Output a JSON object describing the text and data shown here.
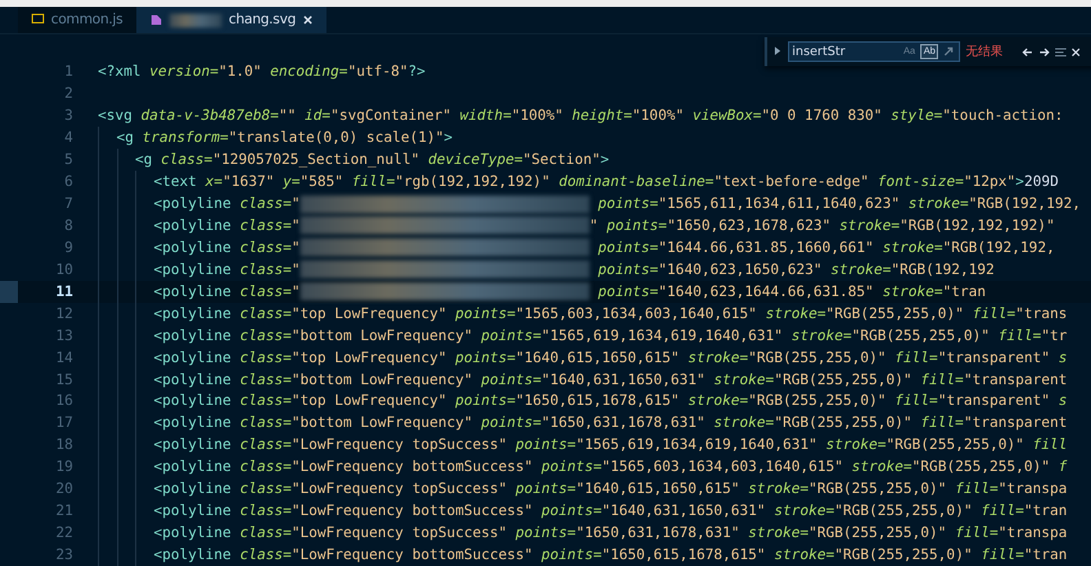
{
  "tabs": [
    {
      "label": "common.js",
      "kind": "js",
      "selected": false,
      "redacted": false,
      "closable": false
    },
    {
      "label": "chang.svg",
      "kind": "svg",
      "selected": true,
      "redacted": true,
      "closable": true
    }
  ],
  "find_widget": {
    "expanded": false,
    "query": "insertStr",
    "options": [
      {
        "kind": "text",
        "label": "Aa",
        "selected": false
      },
      {
        "kind": "text",
        "label": "Ab",
        "selected": true
      },
      {
        "kind": "regex",
        "selected": false
      }
    ],
    "status": "无结果"
  },
  "lines": [
    {
      "number": "1",
      "current": false,
      "tokens": [
        {
          "kind": "tag",
          "text": "<?xml"
        },
        {
          "kind": "attr",
          "text": " version="
        },
        {
          "kind": "string",
          "text": "\"1.0\""
        },
        {
          "kind": "attr",
          "text": " encoding="
        },
        {
          "kind": "string",
          "text": "\"utf-8\""
        },
        {
          "kind": "tag",
          "text": "?>"
        }
      ]
    },
    {
      "number": "2",
      "current": false
    },
    {
      "number": "3",
      "current": false,
      "tokens": [
        {
          "kind": "tag",
          "text": "<svg"
        },
        {
          "kind": "attr",
          "text": " data-v-3b487eb8="
        },
        {
          "kind": "string",
          "text": "\"\""
        },
        {
          "kind": "attr",
          "text": " id="
        },
        {
          "kind": "string",
          "text": "\"svgContainer\""
        },
        {
          "kind": "attr",
          "text": " width="
        },
        {
          "kind": "string",
          "text": "\"100%\""
        },
        {
          "kind": "attr",
          "text": " height="
        },
        {
          "kind": "string",
          "text": "\"100%\""
        },
        {
          "kind": "attr",
          "text": " viewBox="
        },
        {
          "kind": "string",
          "text": "\"0 0 1760 830\""
        },
        {
          "kind": "attr",
          "text": " style="
        },
        {
          "kind": "string",
          "text": "\"touch-action:"
        }
      ]
    },
    {
      "number": "4",
      "current": false,
      "tokens": [
        {
          "kind": "tag",
          "text": "  <g"
        },
        {
          "kind": "attr",
          "text": " transform="
        },
        {
          "kind": "string",
          "text": "\"translate(0,0) scale(1)\""
        },
        {
          "kind": "tag",
          "text": ">"
        }
      ]
    },
    {
      "number": "5",
      "current": false,
      "tokens": [
        {
          "kind": "tag",
          "text": "    <g"
        },
        {
          "kind": "attr",
          "text": " class="
        },
        {
          "kind": "string",
          "text": "\"129057025_Section_null\""
        },
        {
          "kind": "attr",
          "text": " deviceType="
        },
        {
          "kind": "string",
          "text": "\"Section\""
        },
        {
          "kind": "tag",
          "text": ">"
        }
      ]
    },
    {
      "number": "6",
      "current": false,
      "tokens": [
        {
          "kind": "tag",
          "text": "      <text"
        },
        {
          "kind": "attr",
          "text": " x="
        },
        {
          "kind": "string",
          "text": "\"1637\""
        },
        {
          "kind": "attr",
          "text": " y="
        },
        {
          "kind": "string",
          "text": "\"585\""
        },
        {
          "kind": "attr",
          "text": " fill="
        },
        {
          "kind": "string",
          "text": "\"rgb(192,192,192)\""
        },
        {
          "kind": "attr",
          "text": " dominant-baseline="
        },
        {
          "kind": "string",
          "text": "\"text-before-edge\""
        },
        {
          "kind": "attr",
          "text": " font-size="
        },
        {
          "kind": "string",
          "text": "\"12px\""
        },
        {
          "kind": "tag",
          "text": ">"
        },
        {
          "kind": "text",
          "text": "209D"
        }
      ]
    },
    {
      "number": "7",
      "current": false,
      "tokens": [
        {
          "kind": "tag",
          "text": "      <polyline"
        },
        {
          "kind": "attr",
          "text": " class="
        },
        {
          "kind": "string",
          "text": "\""
        },
        {
          "kind": "redacted"
        },
        {
          "kind": "attr",
          "text": " points="
        },
        {
          "kind": "string",
          "text": "\"1565,611,1634,611,1640,623\""
        },
        {
          "kind": "attr",
          "text": " stroke="
        },
        {
          "kind": "string",
          "text": "\"RGB(192,192,"
        }
      ]
    },
    {
      "number": "8",
      "current": false,
      "tokens": [
        {
          "kind": "tag",
          "text": "      <polyline"
        },
        {
          "kind": "attr",
          "text": " class="
        },
        {
          "kind": "string",
          "text": "\""
        },
        {
          "kind": "redacted"
        },
        {
          "kind": "string",
          "text": "\""
        },
        {
          "kind": "attr",
          "text": " points="
        },
        {
          "kind": "string",
          "text": "\"1650,623,1678,623\""
        },
        {
          "kind": "attr",
          "text": " stroke="
        },
        {
          "kind": "string",
          "text": "\"RGB(192,192,192)\""
        }
      ]
    },
    {
      "number": "9",
      "current": false,
      "tokens": [
        {
          "kind": "tag",
          "text": "      <polyline"
        },
        {
          "kind": "attr",
          "text": " class="
        },
        {
          "kind": "string",
          "text": "\""
        },
        {
          "kind": "redacted"
        },
        {
          "kind": "attr",
          "text": " points="
        },
        {
          "kind": "string",
          "text": "\"1644.66,631.85,1660,661\""
        },
        {
          "kind": "attr",
          "text": " stroke="
        },
        {
          "kind": "string",
          "text": "\"RGB(192,192,"
        }
      ]
    },
    {
      "number": "10",
      "current": false,
      "tokens": [
        {
          "kind": "tag",
          "text": "      <polyline"
        },
        {
          "kind": "attr",
          "text": " class="
        },
        {
          "kind": "string",
          "text": "\""
        },
        {
          "kind": "redacted"
        },
        {
          "kind": "attr",
          "text": " points="
        },
        {
          "kind": "string",
          "text": "\"1640,623,1650,623\""
        },
        {
          "kind": "attr",
          "text": " stroke="
        },
        {
          "kind": "string",
          "text": "\"RGB(192,192"
        }
      ]
    },
    {
      "number": "11",
      "current": true,
      "tokens": [
        {
          "kind": "tag",
          "text": "      <polyline"
        },
        {
          "kind": "attr",
          "text": " class="
        },
        {
          "kind": "string",
          "text": "\""
        },
        {
          "kind": "redacted"
        },
        {
          "kind": "attr",
          "text": " points="
        },
        {
          "kind": "string",
          "text": "\"1640,623,1644.66,631.85\""
        },
        {
          "kind": "attr",
          "text": " stroke="
        },
        {
          "kind": "string",
          "text": "\"tran"
        }
      ]
    },
    {
      "number": "12",
      "current": false,
      "tokens": [
        {
          "kind": "tag",
          "text": "      <polyline"
        },
        {
          "kind": "attr",
          "text": " class="
        },
        {
          "kind": "string",
          "text": "\"top LowFrequency\""
        },
        {
          "kind": "attr",
          "text": " points="
        },
        {
          "kind": "string",
          "text": "\"1565,603,1634,603,1640,615\""
        },
        {
          "kind": "attr",
          "text": " stroke="
        },
        {
          "kind": "string",
          "text": "\"RGB(255,255,0)\""
        },
        {
          "kind": "attr",
          "text": " fill="
        },
        {
          "kind": "string",
          "text": "\"trans"
        }
      ]
    },
    {
      "number": "13",
      "current": false,
      "tokens": [
        {
          "kind": "tag",
          "text": "      <polyline"
        },
        {
          "kind": "attr",
          "text": " class="
        },
        {
          "kind": "string",
          "text": "\"bottom LowFrequency\""
        },
        {
          "kind": "attr",
          "text": " points="
        },
        {
          "kind": "string",
          "text": "\"1565,619,1634,619,1640,631\""
        },
        {
          "kind": "attr",
          "text": " stroke="
        },
        {
          "kind": "string",
          "text": "\"RGB(255,255,0)\""
        },
        {
          "kind": "attr",
          "text": " fill="
        },
        {
          "kind": "string",
          "text": "\"tr"
        }
      ]
    },
    {
      "number": "14",
      "current": false,
      "tokens": [
        {
          "kind": "tag",
          "text": "      <polyline"
        },
        {
          "kind": "attr",
          "text": " class="
        },
        {
          "kind": "string",
          "text": "\"top LowFrequency\""
        },
        {
          "kind": "attr",
          "text": " points="
        },
        {
          "kind": "string",
          "text": "\"1640,615,1650,615\""
        },
        {
          "kind": "attr",
          "text": " stroke="
        },
        {
          "kind": "string",
          "text": "\"RGB(255,255,0)\""
        },
        {
          "kind": "attr",
          "text": " fill="
        },
        {
          "kind": "string",
          "text": "\"transparent\""
        },
        {
          "kind": "attr",
          "text": " s"
        }
      ]
    },
    {
      "number": "15",
      "current": false,
      "tokens": [
        {
          "kind": "tag",
          "text": "      <polyline"
        },
        {
          "kind": "attr",
          "text": " class="
        },
        {
          "kind": "string",
          "text": "\"bottom LowFrequency\""
        },
        {
          "kind": "attr",
          "text": " points="
        },
        {
          "kind": "string",
          "text": "\"1640,631,1650,631\""
        },
        {
          "kind": "attr",
          "text": " stroke="
        },
        {
          "kind": "string",
          "text": "\"RGB(255,255,0)\""
        },
        {
          "kind": "attr",
          "text": " fill="
        },
        {
          "kind": "string",
          "text": "\"transparent"
        }
      ]
    },
    {
      "number": "16",
      "current": false,
      "tokens": [
        {
          "kind": "tag",
          "text": "      <polyline"
        },
        {
          "kind": "attr",
          "text": " class="
        },
        {
          "kind": "string",
          "text": "\"top LowFrequency\""
        },
        {
          "kind": "attr",
          "text": " points="
        },
        {
          "kind": "string",
          "text": "\"1650,615,1678,615\""
        },
        {
          "kind": "attr",
          "text": " stroke="
        },
        {
          "kind": "string",
          "text": "\"RGB(255,255,0)\""
        },
        {
          "kind": "attr",
          "text": " fill="
        },
        {
          "kind": "string",
          "text": "\"transparent\""
        },
        {
          "kind": "attr",
          "text": " s"
        }
      ]
    },
    {
      "number": "17",
      "current": false,
      "tokens": [
        {
          "kind": "tag",
          "text": "      <polyline"
        },
        {
          "kind": "attr",
          "text": " class="
        },
        {
          "kind": "string",
          "text": "\"bottom LowFrequency\""
        },
        {
          "kind": "attr",
          "text": " points="
        },
        {
          "kind": "string",
          "text": "\"1650,631,1678,631\""
        },
        {
          "kind": "attr",
          "text": " stroke="
        },
        {
          "kind": "string",
          "text": "\"RGB(255,255,0)\""
        },
        {
          "kind": "attr",
          "text": " fill="
        },
        {
          "kind": "string",
          "text": "\"transparent"
        }
      ]
    },
    {
      "number": "18",
      "current": false,
      "tokens": [
        {
          "kind": "tag",
          "text": "      <polyline"
        },
        {
          "kind": "attr",
          "text": " class="
        },
        {
          "kind": "string",
          "text": "\"LowFrequency topSuccess\""
        },
        {
          "kind": "attr",
          "text": " points="
        },
        {
          "kind": "string",
          "text": "\"1565,619,1634,619,1640,631\""
        },
        {
          "kind": "attr",
          "text": " stroke="
        },
        {
          "kind": "string",
          "text": "\"RGB(255,255,0)\""
        },
        {
          "kind": "attr",
          "text": " fill"
        }
      ]
    },
    {
      "number": "19",
      "current": false,
      "tokens": [
        {
          "kind": "tag",
          "text": "      <polyline"
        },
        {
          "kind": "attr",
          "text": " class="
        },
        {
          "kind": "string",
          "text": "\"LowFrequency bottomSuccess\""
        },
        {
          "kind": "attr",
          "text": " points="
        },
        {
          "kind": "string",
          "text": "\"1565,603,1634,603,1640,615\""
        },
        {
          "kind": "attr",
          "text": " stroke="
        },
        {
          "kind": "string",
          "text": "\"RGB(255,255,0)\""
        },
        {
          "kind": "attr",
          "text": " f"
        }
      ]
    },
    {
      "number": "20",
      "current": false,
      "tokens": [
        {
          "kind": "tag",
          "text": "      <polyline"
        },
        {
          "kind": "attr",
          "text": " class="
        },
        {
          "kind": "string",
          "text": "\"LowFrequency topSuccess\""
        },
        {
          "kind": "attr",
          "text": " points="
        },
        {
          "kind": "string",
          "text": "\"1640,615,1650,615\""
        },
        {
          "kind": "attr",
          "text": " stroke="
        },
        {
          "kind": "string",
          "text": "\"RGB(255,255,0)\""
        },
        {
          "kind": "attr",
          "text": " fill="
        },
        {
          "kind": "string",
          "text": "\"transpa"
        }
      ]
    },
    {
      "number": "21",
      "current": false,
      "tokens": [
        {
          "kind": "tag",
          "text": "      <polyline"
        },
        {
          "kind": "attr",
          "text": " class="
        },
        {
          "kind": "string",
          "text": "\"LowFrequency bottomSuccess\""
        },
        {
          "kind": "attr",
          "text": " points="
        },
        {
          "kind": "string",
          "text": "\"1640,631,1650,631\""
        },
        {
          "kind": "attr",
          "text": " stroke="
        },
        {
          "kind": "string",
          "text": "\"RGB(255,255,0)\""
        },
        {
          "kind": "attr",
          "text": " fill="
        },
        {
          "kind": "string",
          "text": "\"tran"
        }
      ]
    },
    {
      "number": "22",
      "current": false,
      "tokens": [
        {
          "kind": "tag",
          "text": "      <polyline"
        },
        {
          "kind": "attr",
          "text": " class="
        },
        {
          "kind": "string",
          "text": "\"LowFrequency topSuccess\""
        },
        {
          "kind": "attr",
          "text": " points="
        },
        {
          "kind": "string",
          "text": "\"1650,631,1678,631\""
        },
        {
          "kind": "attr",
          "text": " stroke="
        },
        {
          "kind": "string",
          "text": "\"RGB(255,255,0)\""
        },
        {
          "kind": "attr",
          "text": " fill="
        },
        {
          "kind": "string",
          "text": "\"transpa"
        }
      ]
    },
    {
      "number": "23",
      "current": false,
      "tokens": [
        {
          "kind": "tag",
          "text": "      <polyline"
        },
        {
          "kind": "attr",
          "text": " class="
        },
        {
          "kind": "string",
          "text": "\"LowFrequency bottomSuccess\""
        },
        {
          "kind": "attr",
          "text": " points="
        },
        {
          "kind": "string",
          "text": "\"1650,615,1678,615\""
        },
        {
          "kind": "attr",
          "text": " stroke="
        },
        {
          "kind": "string",
          "text": "\"RGB(255,255,0)\""
        },
        {
          "kind": "attr",
          "text": " fill="
        },
        {
          "kind": "string",
          "text": "\"tran"
        }
      ]
    }
  ]
}
